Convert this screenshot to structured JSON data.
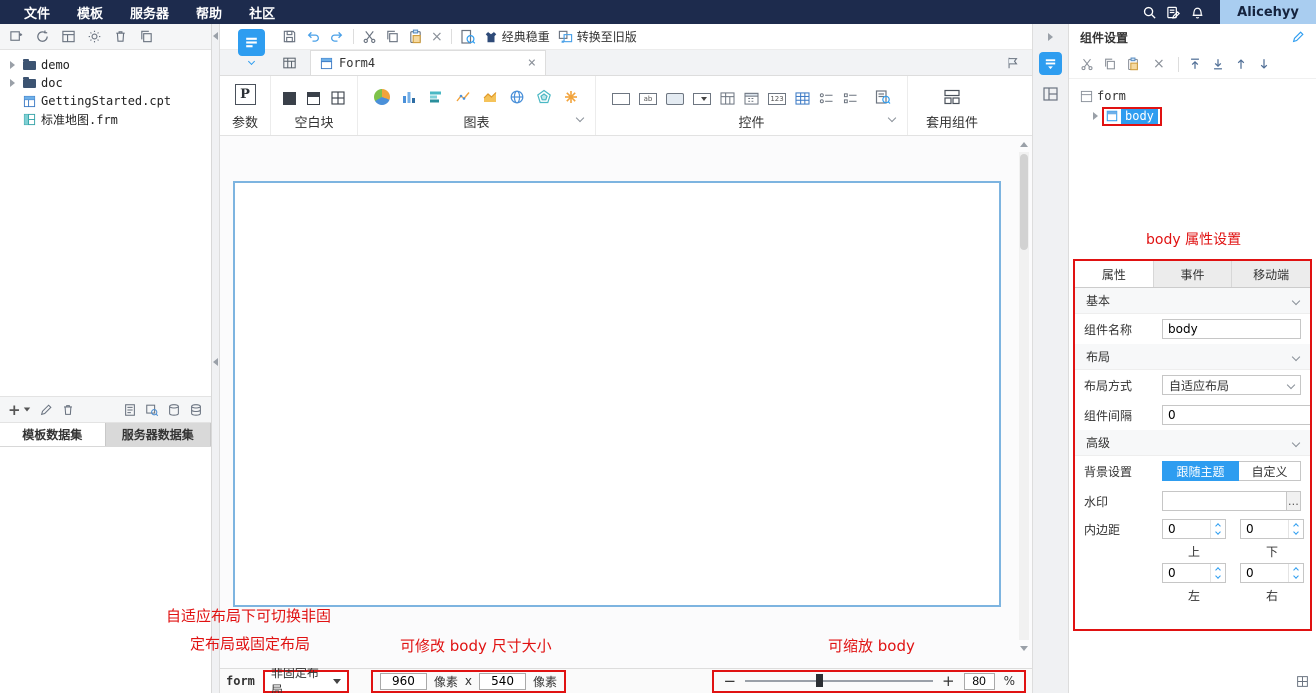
{
  "menubar": {
    "items": [
      "文件",
      "模板",
      "服务器",
      "帮助",
      "社区"
    ],
    "user": "Alicehyy"
  },
  "sidebar": {
    "tree": [
      {
        "label": "demo"
      },
      {
        "label": "doc"
      },
      {
        "label": "GettingStarted.cpt"
      },
      {
        "label": "标准地图.frm"
      }
    ],
    "dataset_tabs": [
      "模板数据集",
      "服务器数据集"
    ]
  },
  "toolbar": {
    "style_label": "经典稳重",
    "convert_label": "转换至旧版"
  },
  "doc_tab": "Form4",
  "widgets": {
    "param": {
      "icon": "P",
      "label": "参数"
    },
    "blank": {
      "label": "空白块"
    },
    "chart": {
      "label": "图表"
    },
    "control": {
      "label": "控件",
      "ab_icon": "ab",
      "num_icon": "123"
    },
    "component": {
      "label": "套用组件"
    }
  },
  "statusbar": {
    "scope": "form",
    "layout_mode": "非固定布局",
    "width": "960",
    "width_unit": "像素",
    "times": "x",
    "height": "540",
    "height_unit": "像素",
    "minus": "−",
    "plus": "+",
    "zoom": "80",
    "zoom_unit": "%"
  },
  "annotations": {
    "layout_line1": "自适应布局下可切换非固",
    "layout_line2": "定布局或固定布局",
    "size_note": "可修改 body 尺寸大小",
    "zoom_note": "可缩放 body",
    "props_note": "body 属性设置"
  },
  "right_panel": {
    "title": "组件设置",
    "tree_root": "form",
    "tree_child": "body",
    "tabs": [
      "属性",
      "事件",
      "移动端"
    ],
    "section_basic": "基本",
    "section_layout": "布局",
    "section_advanced": "高级",
    "name_label": "组件名称",
    "name_value": "body",
    "layout_label": "布局方式",
    "layout_value": "自适应布局",
    "gap_label": "组件间隔",
    "gap_value": "0",
    "bg_label": "背景设置",
    "bg_follow": "跟随主题",
    "bg_custom": "自定义",
    "watermark_label": "水印",
    "watermark_more": "…",
    "padding_label": "内边距",
    "pad_top": "0",
    "pad_bottom": "0",
    "pad_left": "0",
    "pad_right": "0",
    "pos_top": "上",
    "pos_bottom": "下",
    "pos_left": "左",
    "pos_right": "右"
  }
}
